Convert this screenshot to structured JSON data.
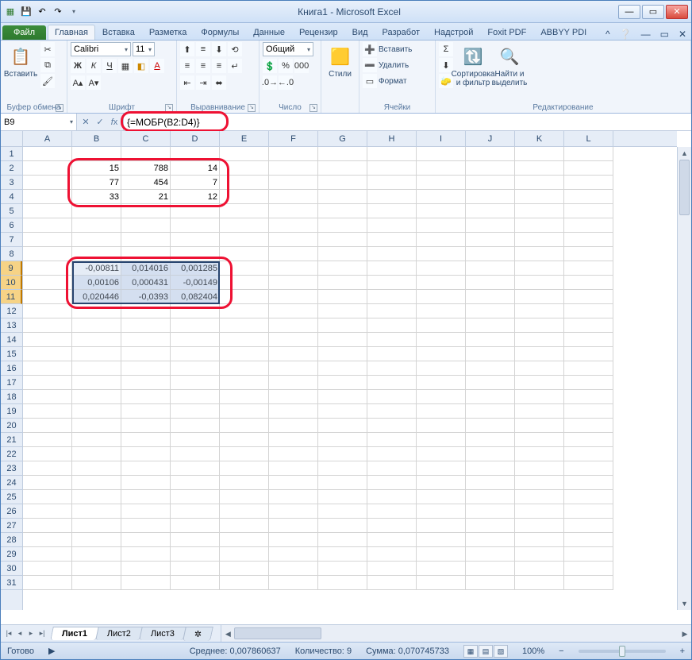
{
  "title": "Книга1 - Microsoft Excel",
  "qat": {
    "save_tip": "💾",
    "undo_tip": "↶",
    "redo_tip": "↷"
  },
  "tabs": {
    "file": "Файл",
    "home": "Главная",
    "insert": "Вставка",
    "layout": "Разметка",
    "formulas": "Формулы",
    "data": "Данные",
    "review": "Рецензир",
    "view": "Вид",
    "developer": "Разработ",
    "addins": "Надстрой",
    "foxit": "Foxit PDF",
    "abbyy": "ABBYY PDI"
  },
  "ribbon": {
    "paste": "Вставить",
    "clipboard_label": "Буфер обмена",
    "font_name": "Calibri",
    "font_size": "11",
    "font_label": "Шрифт",
    "align_label": "Выравнивание",
    "numfmt": "Общий",
    "number_label": "Число",
    "styles": "Стили",
    "cells_insert": "Вставить",
    "cells_delete": "Удалить",
    "cells_format": "Формат",
    "cells_label": "Ячейки",
    "sort_filter": "Сортировка\nи фильтр",
    "find_select": "Найти и\nвыделить",
    "editing_label": "Редактирование"
  },
  "namebox": "B9",
  "formula": "{=МОБР(B2:D4)}",
  "columns": [
    "A",
    "B",
    "C",
    "D",
    "E",
    "F",
    "G",
    "H",
    "I",
    "J",
    "K",
    "L"
  ],
  "row_count": 31,
  "selected_rows": [
    9,
    10,
    11
  ],
  "matrix1": {
    "row_start": 2,
    "col_start": 2,
    "data": [
      [
        "15",
        "788",
        "14"
      ],
      [
        "77",
        "454",
        "7"
      ],
      [
        "33",
        "21",
        "12"
      ]
    ]
  },
  "matrix2": {
    "row_start": 9,
    "col_start": 2,
    "data": [
      [
        "-0,00811",
        "0,014016",
        "0,001285"
      ],
      [
        "0,00106",
        "0,000431",
        "-0,00149"
      ],
      [
        "0,020446",
        "-0,0393",
        "0,082404"
      ]
    ]
  },
  "sheets": [
    "Лист1",
    "Лист2",
    "Лист3"
  ],
  "active_sheet": 0,
  "status": {
    "ready": "Готово",
    "avg_label": "Среднее:",
    "avg": "0,007860637",
    "count_label": "Количество:",
    "count": "9",
    "sum_label": "Сумма:",
    "sum": "0,070745733",
    "zoom": "100%"
  }
}
